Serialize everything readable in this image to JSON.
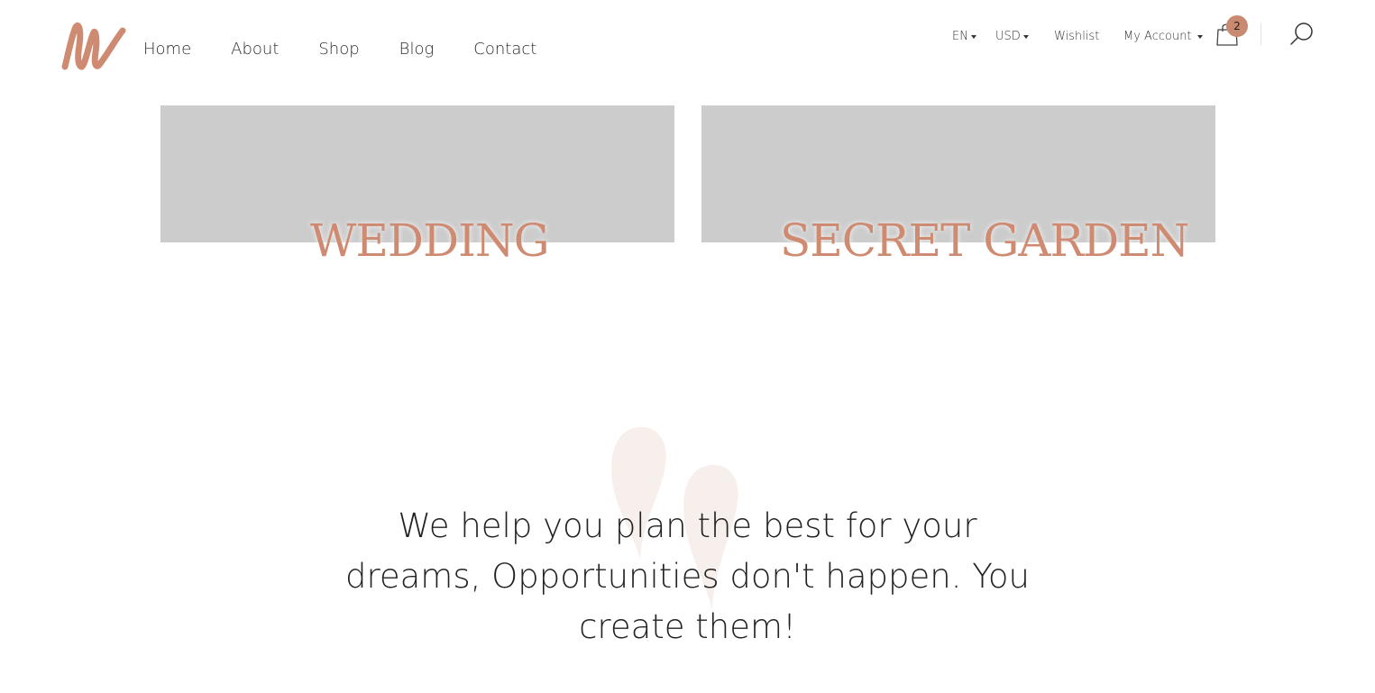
{
  "nav": {
    "items": [
      {
        "label": "Home"
      },
      {
        "label": "About"
      },
      {
        "label": "Shop"
      },
      {
        "label": "Blog"
      },
      {
        "label": "Contact"
      }
    ]
  },
  "utility": {
    "language": "EN",
    "currency": "USD",
    "wishlist": "Wishlist",
    "account": "My Account",
    "cart_count": "2"
  },
  "cards": [
    {
      "title": "WEDDING"
    },
    {
      "title": "SECRET GARDEN"
    }
  ],
  "quote": {
    "text": "We help you plan the best for your dreams, Opportunities don't happen. You create them!"
  },
  "colors": {
    "accent": "#cf8b72",
    "badge": "#c98a72",
    "card_placeholder": "#cccccc",
    "quote_mark": "#f7efec"
  },
  "icons": {
    "logo": "brand-logo-icon",
    "cart": "shopping-bag-icon",
    "search": "search-icon",
    "dropdown": "caret-down-icon",
    "quote": "quote-mark-icon"
  }
}
